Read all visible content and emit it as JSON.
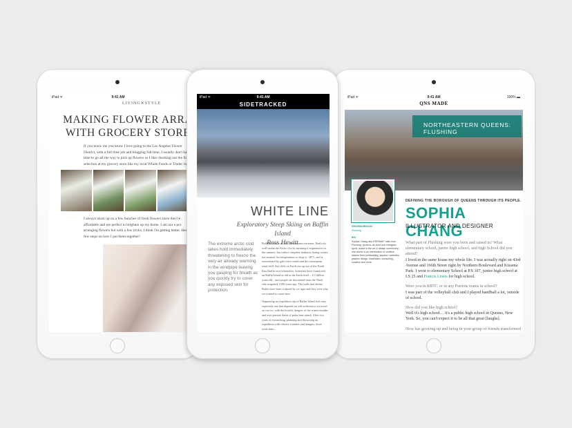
{
  "left": {
    "status": {
      "carrier": "iPad ᯤ",
      "time": "9:41 AM"
    },
    "brand": "LIVING✕STYLE",
    "title_line1": "MAKING FLOWER ARRANG",
    "title_line2": "WITH GROCERY STORE FL",
    "para1": "I always stock up on a few bunches of fresh flowers since they're affordable and are perfect to brighten up my home. I am not a pro arranging flowers but with a few tricks, I think I'm getting better. Here are few steps on how I put them together!",
    "intro": "If you know me you know I love going to the Los Angeles Flower District, with a full time job and blogging full time, I usually don't have time to go all the way to pick up flowers so I like checking out the flower selection at my grocery store like my local Whole Foods or Trader Joe's."
  },
  "center": {
    "status": {
      "carrier": "iPad ᯤ",
      "time": "9:41 AM"
    },
    "logo": "SIDETRACKED",
    "title": "WHITE LINES",
    "subtitle": "Exploratory Steep Skiing on Baffin Island",
    "author": "Ross Hewitt",
    "pullquote": "The extreme arctic cold takes hold immediately threatening to freeze the very air already warming in the windpipe leaving you gasping for breath as you quickly try to cover any exposed skin for protection.",
    "body1": "Baffin Island is an area that defines extremes. Earth sits well within the Arctic Circle, meaning it experiences in the summer, but suffers complete darkness during winter, not unusual for temperatures to drop to -30°C, and is exacerbated by gale force winds and the consequent wind chill. Sea cliffs on Earth rise up out of the North East Baffin over kilometres. Scientists have found rock on Baffin Island as old as the Earth itself – 4.5 billion years old – and people are descended from the Thule who migrated 1,000 years ago. The walls that define Baffin have been sculpted by ice ages and they were why we wanted to come here.",
    "body2": "Organizing an expedition trip to Baffin Island isn't easy, especially one that depends on self-sufficiency for travel on sea ice, with the horrific dangers of the winter months and ever-present threat of polar bear attack. After two years of researching, planning and discussing an expedition with relative wonders and dangers, three years later..."
  },
  "right": {
    "status": {
      "carrier": "iPad ᯤ",
      "time": "9:41 AM",
      "battery": "100% ▬"
    },
    "header": "QNS MADE",
    "banner": "NORTHEASTERN QUEENS: FLUSHING",
    "kicker": "DEFINING THE BOROUGH OF QUEENS THROUGH ITS PEOPLE.",
    "name": "SOPHIA CHANG",
    "role": "ILLUSTRATOR AND DESIGNER",
    "side_label1": "NEIGHBORHOOD",
    "side_value1": "Flushing",
    "side_label2": "BIO",
    "side_bio": "Sophia Chang aka 'ESPIMAY' hails from Flushing, Queens. An avid and energetic sport, active in the art & design community, she works in an intersection of creative realms from printmaking, apparel, websites, graphic design, illustration, consulting, curation and more.",
    "q1": "What part of Flushing were you born and raised in? What elementary school, junior high school, and high School did you attend?",
    "a1": "I lived in the same house my whole life. I was actually right on 43rd Avenue and 166th Street right by Northern Boulevard and Kissena Park. I went to elementary School at P.S 107, junior high school at I.S 25 and",
    "a1_link": "Francis Lewis",
    "a1_end": "for high school.",
    "q2": "Were you in RBTC or in any Patriots teams in school?",
    "a2": "I was part of the volleyball club and I played handball a lot, outside of school.",
    "q3": "How did you like high school?",
    "a3": "Well it's high school… it's a public high school in Queens, New York. So, you can't expect it to be all that great [laughs].",
    "q4": "How has growing up and being in your group of friends transformed you"
  }
}
